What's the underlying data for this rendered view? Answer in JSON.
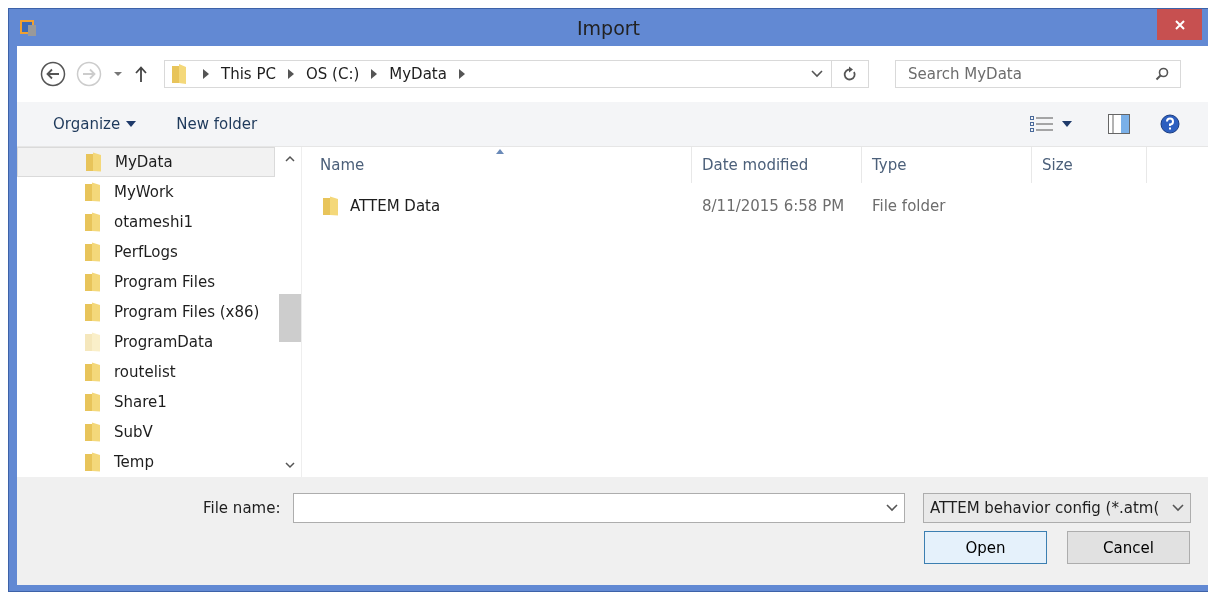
{
  "window": {
    "title": "Import"
  },
  "address": {
    "crumbs": [
      "This PC",
      "OS (C:)",
      "MyData"
    ]
  },
  "search": {
    "placeholder": "Search MyData"
  },
  "toolbar": {
    "organize": "Organize",
    "new_folder": "New folder"
  },
  "sidebar": {
    "items": [
      {
        "label": "MyData",
        "selected": true,
        "hidden": false
      },
      {
        "label": "MyWork",
        "selected": false,
        "hidden": false
      },
      {
        "label": "otameshi1",
        "selected": false,
        "hidden": false
      },
      {
        "label": "PerfLogs",
        "selected": false,
        "hidden": false
      },
      {
        "label": "Program Files",
        "selected": false,
        "hidden": false
      },
      {
        "label": "Program Files (x86)",
        "selected": false,
        "hidden": false
      },
      {
        "label": "ProgramData",
        "selected": false,
        "hidden": true
      },
      {
        "label": "routelist",
        "selected": false,
        "hidden": false
      },
      {
        "label": "Share1",
        "selected": false,
        "hidden": false
      },
      {
        "label": "SubV",
        "selected": false,
        "hidden": false
      },
      {
        "label": "Temp",
        "selected": false,
        "hidden": false
      }
    ]
  },
  "table": {
    "columns": [
      "Name",
      "Date modified",
      "Type",
      "Size"
    ],
    "rows": [
      {
        "name": "ATTEM Data",
        "date": "8/11/2015 6:58 PM",
        "type": "File folder"
      }
    ]
  },
  "footer": {
    "file_name_label": "File name:",
    "file_type": "ATTEM behavior config (*.atm(",
    "buttons": [
      "Open",
      "Cancel"
    ]
  }
}
